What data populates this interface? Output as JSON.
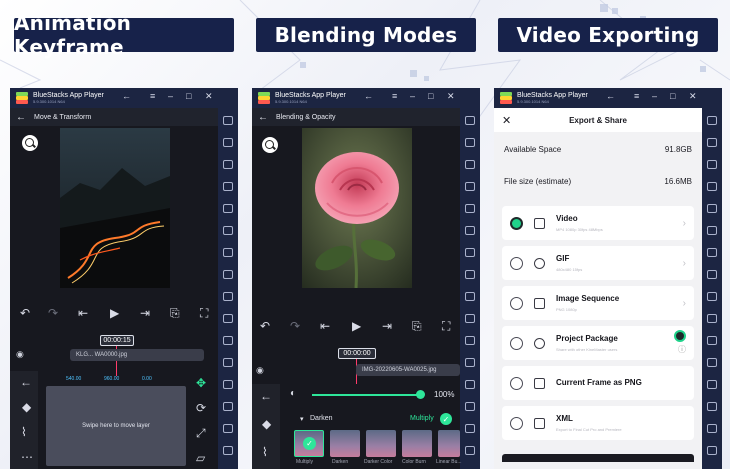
{
  "banners": {
    "keyframe": "Animation Keyframe",
    "blending": "Blending Modes",
    "exporting": "Video Exporting"
  },
  "bluestacks": {
    "title": "BlueStacks App Player",
    "subtitle": "5.9.300.1014 N64"
  },
  "panel1": {
    "section_title": "Move & Transform",
    "timecode": "00:00:15",
    "track_label": "KLG... WA0000.jpg",
    "field_values": [
      "540.00",
      "960.00",
      "0.00"
    ],
    "swipe_hint": "Swipe here to move layer"
  },
  "panel2": {
    "section_title": "Blending & Opacity",
    "timecode": "00:00:00",
    "track_label": "IMG-20220605-WA0025.jpg",
    "opacity": "100%",
    "current_mode": "Darken",
    "selected_mode": "Multiply",
    "thumbnails": [
      "Multiply",
      "Darken",
      "Darker Color",
      "Color Burn",
      "Linear Bu..."
    ]
  },
  "panel3": {
    "header": "Export & Share",
    "available_space_label": "Available Space",
    "available_space_value": "91.8GB",
    "file_size_label": "File size (estimate)",
    "file_size_value": "16.6MB",
    "options": [
      {
        "title": "Video",
        "sub": "MP4 1080p 30fps 48Mbps",
        "selected": true,
        "icon": "video-icon"
      },
      {
        "title": "GIF",
        "sub": "480x480 15fps",
        "selected": false,
        "icon": "gif-icon"
      },
      {
        "title": "Image Sequence",
        "sub": "PNG 1080p",
        "selected": false,
        "icon": "image-sequence-icon"
      },
      {
        "title": "Project Package",
        "sub": "Share with other KineMaster users",
        "selected": false,
        "icon": "package-icon"
      },
      {
        "title": "Current Frame as PNG",
        "sub": "",
        "selected": false,
        "icon": "image-icon"
      },
      {
        "title": "XML",
        "sub": "Export to Final Cut Pro and Premiere",
        "selected": false,
        "icon": "xml-icon"
      }
    ]
  },
  "colors": {
    "banner_bg": "#17224a",
    "accent_green": "#1fd28a",
    "playhead": "#ff3b6b",
    "editor_bg": "#17181f"
  }
}
